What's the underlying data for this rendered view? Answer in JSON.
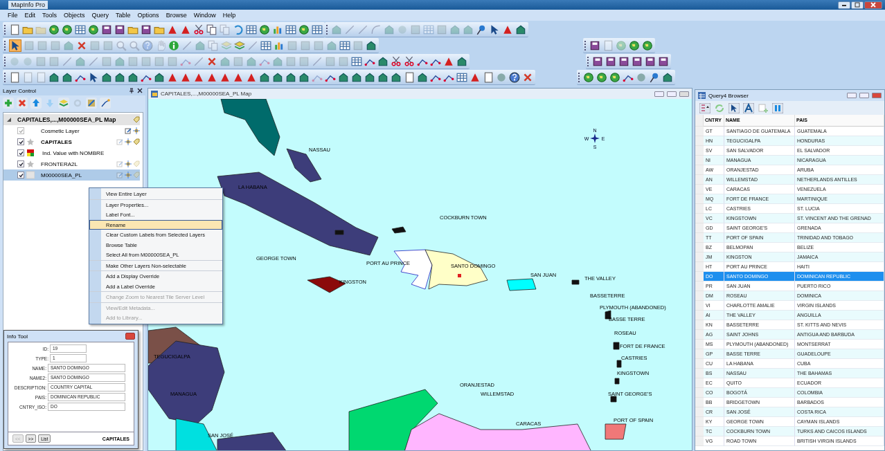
{
  "window": {
    "title": "MapInfo Pro"
  },
  "menu_bar": [
    "File",
    "Edit",
    "Tools",
    "Objects",
    "Query",
    "Table",
    "Options",
    "Browse",
    "Window",
    "Help"
  ],
  "layer_control": {
    "title": "Layer Control",
    "tree": [
      {
        "label": "CAPITALES,...,M00000SEA_PL Map",
        "expanded": true,
        "children": [
          {
            "label": "Cosmetic Layer",
            "kind": "cosmetic",
            "checked": true,
            "check_disabled": true,
            "selected": false
          },
          {
            "label": "CAPITALES",
            "kind": "point",
            "checked": true,
            "check_disabled": false,
            "selected": false,
            "children": [
              {
                "label": "Ind. Value with NOMBRE",
                "kind": "theme",
                "checked": true,
                "check_disabled": false,
                "selected": false
              }
            ]
          },
          {
            "label": "FRONTERA2L",
            "kind": "line",
            "checked": true,
            "check_disabled": false,
            "selected": false
          },
          {
            "label": "M00000SEA_PL",
            "kind": "region",
            "checked": true,
            "check_disabled": false,
            "selected": true
          }
        ]
      }
    ]
  },
  "context_menu": {
    "groups": [
      [
        {
          "label": "View Entire Layer",
          "disabled": false,
          "selected": false
        }
      ],
      [
        {
          "label": "Layer Properties...",
          "disabled": false,
          "selected": false
        },
        {
          "label": "Label Font...",
          "disabled": false,
          "selected": false
        },
        {
          "label": "Rename",
          "disabled": false,
          "selected": true
        },
        {
          "label": "Clear Custom Labels from Selected Layers",
          "disabled": false,
          "selected": false
        },
        {
          "label": "Browse Table",
          "disabled": false,
          "selected": false
        },
        {
          "label": "Select All from M00000SEA_PL",
          "disabled": false,
          "selected": false
        }
      ],
      [
        {
          "label": "Make Other Layers Non-selectable",
          "disabled": false,
          "selected": false
        }
      ],
      [
        {
          "label": "Add a Display Override",
          "disabled": false,
          "selected": false
        },
        {
          "label": "Add a Label Override",
          "disabled": false,
          "selected": false
        }
      ],
      [
        {
          "label": "Change Zoom to Nearest Tile Server Level",
          "disabled": true,
          "selected": false
        }
      ],
      [
        {
          "label": "View/Edit Metadata...",
          "disabled": true,
          "selected": false
        },
        {
          "label": "Add to Library...",
          "disabled": true,
          "selected": false
        }
      ]
    ]
  },
  "info_tool": {
    "title": "Info Tool",
    "fields": [
      {
        "label": "ID:",
        "value": "19",
        "kind": "short"
      },
      {
        "label": "TYPE:",
        "value": "1",
        "kind": "short"
      },
      {
        "label": "NAME:",
        "value": "SANTO DOMINGO",
        "kind": "long"
      },
      {
        "label": "NAME2:",
        "value": "SANTO DOMINGO",
        "kind": "long"
      },
      {
        "label": "DESCRIPTION:",
        "value": "COUNTRY CAPITAL",
        "kind": "long"
      },
      {
        "label": "PAIS:",
        "value": "DOMINICAN REPUBLIC",
        "kind": "long"
      },
      {
        "label": "CNTRY_ISO:",
        "value": "DO",
        "kind": "long"
      }
    ],
    "buttons": [
      {
        "label": "<<",
        "disabled": true
      },
      {
        "label": ">>",
        "disabled": false
      },
      {
        "label": "List",
        "disabled": false
      }
    ],
    "table": "CAPITALES"
  },
  "map_window": {
    "title": "CAPITALES,...,M00000SEA_PL Map",
    "compass": {
      "n": "N",
      "w": "W",
      "e": "E",
      "s": "S"
    },
    "labels": [
      "NASSAU",
      "LA HABANA",
      "COCKBURN TOWN",
      "GEORGE TOWN",
      "PORT AU PRINCE",
      "SANTO DOMINGO",
      "SAN JUAN",
      "KINGSTON",
      "THE VALLEY",
      "BASSETERRE",
      "PLYMOUTH (ABANDONED)",
      "BASSE TERRE",
      "ROSEAU",
      "FORT DE FRANCE",
      "CASTRIES",
      "KINGSTOWN",
      "SAINT GEORGE'S",
      "ORANJESTAD",
      "WILLEMSTAD",
      "CARACAS",
      "PORT OF SPAIN",
      "TEGUCIGALPA",
      "MANAGUA",
      "SAN JOSÉ"
    ]
  },
  "browser": {
    "title": "Query4 Browser",
    "columns": [
      "CNTRY",
      "NAME",
      "PAIS"
    ],
    "rows": [
      {
        "cells": [
          "GT",
          "SANTIAGO DE GUATEMALA",
          "GUATEMALA"
        ],
        "selected": false
      },
      {
        "cells": [
          "HN",
          "TEGUCIGALPA",
          "HONDURAS"
        ],
        "selected": false
      },
      {
        "cells": [
          "SV",
          "SAN SALVADOR",
          "EL SALVADOR"
        ],
        "selected": false
      },
      {
        "cells": [
          "NI",
          "MANAGUA",
          "NICARAGUA"
        ],
        "selected": false
      },
      {
        "cells": [
          "AW",
          "ORANJESTAD",
          "ARUBA"
        ],
        "selected": false
      },
      {
        "cells": [
          "AN",
          "WILLEMSTAD",
          "NETHERLANDS ANTILLES"
        ],
        "selected": false
      },
      {
        "cells": [
          "VE",
          "CARACAS",
          "VENEZUELA"
        ],
        "selected": false
      },
      {
        "cells": [
          "MQ",
          "FORT DE FRANCE",
          "MARTINIQUE"
        ],
        "selected": false
      },
      {
        "cells": [
          "LC",
          "CASTRIES",
          "ST. LUCIA"
        ],
        "selected": false
      },
      {
        "cells": [
          "VC",
          "KINGSTOWN",
          "ST. VINCENT AND THE GRENAD"
        ],
        "selected": false
      },
      {
        "cells": [
          "GD",
          "SAINT GEORGE'S",
          "GRENADA"
        ],
        "selected": false
      },
      {
        "cells": [
          "TT",
          "PORT OF SPAIN",
          "TRINIDAD AND TOBAGO"
        ],
        "selected": false
      },
      {
        "cells": [
          "BZ",
          "BELMOPAN",
          "BELIZE"
        ],
        "selected": false
      },
      {
        "cells": [
          "JM",
          "KINGSTON",
          "JAMAICA"
        ],
        "selected": false
      },
      {
        "cells": [
          "HT",
          "PORT AU PRINCE",
          "HAITI"
        ],
        "selected": false
      },
      {
        "cells": [
          "DO",
          "SANTO DOMINGO",
          "DOMINICAN REPUBLIC"
        ],
        "selected": true
      },
      {
        "cells": [
          "PR",
          "SAN JUAN",
          "PUERTO RICO"
        ],
        "selected": false
      },
      {
        "cells": [
          "DM",
          "ROSEAU",
          "DOMINICA"
        ],
        "selected": false
      },
      {
        "cells": [
          "VI",
          "CHARLOTTE AMALIE",
          "VIRGIN ISLANDS"
        ],
        "selected": false
      },
      {
        "cells": [
          "AI",
          "THE VALLEY",
          "ANGUILLA"
        ],
        "selected": false
      },
      {
        "cells": [
          "KN",
          "BASSETERRE",
          "ST. KITTS AND NEVIS"
        ],
        "selected": false
      },
      {
        "cells": [
          "AG",
          "SAINT JOHNS",
          "ANTIGUA AND BARBUDA"
        ],
        "selected": false
      },
      {
        "cells": [
          "MS",
          "PLYMOUTH (ABANDONED)",
          "MONTSERRAT"
        ],
        "selected": false
      },
      {
        "cells": [
          "GP",
          "BASSE TERRE",
          "GUADELOUPE"
        ],
        "selected": false
      },
      {
        "cells": [
          "CU",
          "LA HABANA",
          "CUBA"
        ],
        "selected": false
      },
      {
        "cells": [
          "BS",
          "NASSAU",
          "THE BAHAMAS"
        ],
        "selected": false
      },
      {
        "cells": [
          "EC",
          "QUITO",
          "ECUADOR"
        ],
        "selected": false
      },
      {
        "cells": [
          "CO",
          "BOGOTÁ",
          "COLOMBIA"
        ],
        "selected": false
      },
      {
        "cells": [
          "BB",
          "BRIDGETOWN",
          "BARBADOS"
        ],
        "selected": false
      },
      {
        "cells": [
          "CR",
          "SAN JOSÉ",
          "COSTA RICA"
        ],
        "selected": false
      },
      {
        "cells": [
          "KY",
          "GEORGE TOWN",
          "CAYMAN ISLANDS"
        ],
        "selected": false
      },
      {
        "cells": [
          "TC",
          "COCKBURN TOWN",
          "TURKS AND CAICOS ISLANDS"
        ],
        "selected": false
      },
      {
        "cells": [
          "VG",
          "ROAD TOWN",
          "BRITISH VIRGIN ISLANDS"
        ],
        "selected": false
      }
    ]
  }
}
